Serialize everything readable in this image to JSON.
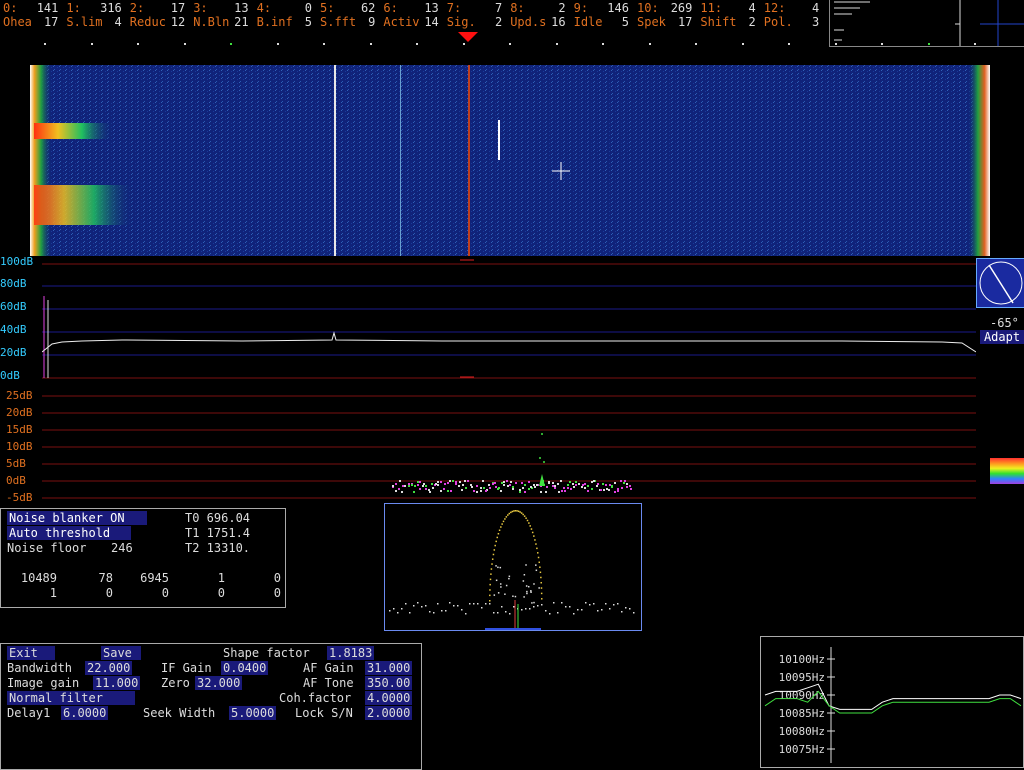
{
  "status_bar": {
    "row1": [
      {
        "label": "0:",
        "value": "141"
      },
      {
        "label": "1:",
        "value": "316"
      },
      {
        "label": "2:",
        "value": "17"
      },
      {
        "label": "3:",
        "value": "13"
      },
      {
        "label": "4:",
        "value": "0"
      },
      {
        "label": "5:",
        "value": "62"
      },
      {
        "label": "6:",
        "value": "13"
      },
      {
        "label": "7:",
        "value": "7"
      },
      {
        "label": "8:",
        "value": "2"
      },
      {
        "label": "9:",
        "value": "146"
      },
      {
        "label": "10:",
        "value": "269"
      },
      {
        "label": "11:",
        "value": "4"
      },
      {
        "label": "12:",
        "value": "4"
      }
    ],
    "row2": [
      {
        "label": "Ohea",
        "value": "17"
      },
      {
        "label": "S.lim",
        "value": "4"
      },
      {
        "label": "Reduc",
        "value": "12"
      },
      {
        "label": "N.Bln",
        "value": "21"
      },
      {
        "label": "B.inf",
        "value": "5"
      },
      {
        "label": "S.fft",
        "value": "9"
      },
      {
        "label": "Activ",
        "value": "14"
      },
      {
        "label": "Sig.",
        "value": "2"
      },
      {
        "label": "Upd.s",
        "value": "16"
      },
      {
        "label": "Idle",
        "value": "5"
      },
      {
        "label": "Spek",
        "value": "17"
      },
      {
        "label": "Shift",
        "value": "2"
      },
      {
        "label": "Pol.",
        "value": "3"
      }
    ]
  },
  "spectrum_scale": {
    "upper": [
      "100dB",
      "80dB",
      "60dB",
      "40dB",
      "20dB",
      "0dB"
    ],
    "lower": [
      "25dB",
      "20dB",
      "15dB",
      "10dB",
      "5dB",
      "0dB",
      "-5dB"
    ]
  },
  "polarization": {
    "angle": "-65°",
    "mode": "Adapt"
  },
  "noise_panel": {
    "blanker": "Noise blanker ON",
    "threshold": "Auto threshold",
    "floor_label": "Noise floor",
    "floor_value": "246",
    "t0": "T0 696.04",
    "t1": "T1 1751.4",
    "t2": "T2 13310.",
    "row_a": [
      "10489",
      "78",
      "6945",
      "1",
      "0"
    ],
    "row_b": [
      "1",
      "0",
      "0",
      "0",
      "0"
    ]
  },
  "filter_panel": {
    "exit": "Exit",
    "save": "Save",
    "shape_label": "Shape factor",
    "shape_value": "1.8183",
    "bandwidth_label": "Bandwidth",
    "bandwidth_value": "22.000",
    "ifgain_label": "IF Gain",
    "ifgain_value": "0.0400",
    "afgain_label": "AF Gain",
    "afgain_value": "31.000",
    "imagegain_label": "Image gain",
    "imagegain_value": "11.000",
    "zero_label": "Zero",
    "zero_value": "32.000",
    "aftone_label": "AF Tone",
    "aftone_value": "350.00",
    "normal_filter": "Normal filter",
    "coh_label": "Coh.factor",
    "coh_value": "4.0000",
    "delay_label": "Delay1",
    "delay_value": "6.0000",
    "seek_label": "Seek Width",
    "seek_value": "5.0000",
    "lock_label": "Lock S/N",
    "lock_value": "2.0000"
  },
  "freq_graph": {
    "ticks": [
      "10100Hz",
      "10095Hz",
      "10090Hz",
      "10085Hz",
      "10080Hz",
      "10075Hz"
    ]
  },
  "chart_data": {
    "type": "line",
    "yticks": [
      10100,
      10095,
      10090,
      10085,
      10080,
      10075
    ],
    "ylim": [
      10075,
      10100
    ],
    "series": [
      {
        "color": "#ffffff",
        "values": [
          10090,
          10091,
          10091,
          10091,
          10092,
          10093,
          10087,
          10086,
          10086,
          10086,
          10086,
          10088,
          10089,
          10089,
          10089,
          10089,
          10089,
          10089,
          10089,
          10089,
          10089,
          10089,
          10090,
          10090,
          10089
        ]
      },
      {
        "color": "#40e040",
        "values": [
          10087,
          10089,
          10089,
          10089,
          10088,
          10091,
          10087,
          10085,
          10085,
          10085,
          10085,
          10087,
          10088,
          10088,
          10088,
          10088,
          10088,
          10088,
          10088,
          10088,
          10088,
          10088,
          10089,
          10089,
          10087
        ]
      }
    ]
  }
}
